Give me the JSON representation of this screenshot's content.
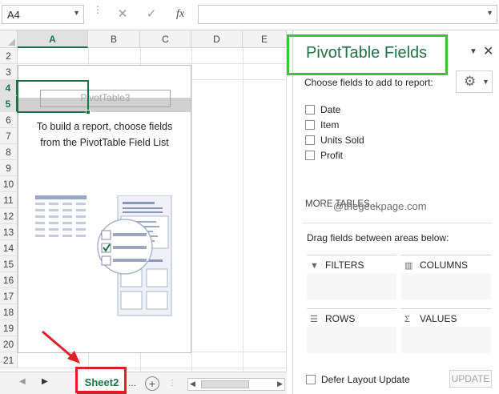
{
  "formula_bar": {
    "namebox_value": "A4",
    "fx_label": "fx",
    "formula_value": ""
  },
  "grid": {
    "columns": [
      "A",
      "B",
      "C",
      "D",
      "E"
    ],
    "selected_column": "A",
    "rows": [
      "2",
      "3",
      "4",
      "5",
      "6",
      "7",
      "8",
      "9",
      "10",
      "11",
      "12",
      "13",
      "14",
      "15",
      "16",
      "17",
      "18",
      "19",
      "20",
      "21"
    ],
    "selected_rows": [
      "4",
      "5"
    ],
    "pivot_name": "PivotTable3",
    "pivot_instruction_line1": "To build a report, choose fields",
    "pivot_instruction_line2": "from the PivotTable Field List"
  },
  "tabs": {
    "active_sheet": "Sheet2",
    "more": "...",
    "add": "+"
  },
  "pane": {
    "title": "PivotTable Fields",
    "choose_label": "Choose fields to add to report:",
    "fields": [
      "Date",
      "Item",
      "Units Sold",
      "Profit"
    ],
    "more_tables": "MORE TABLES...",
    "watermark": "@thegeekpage.com",
    "drag_label": "Drag fields between areas below:",
    "areas": {
      "filters": "FILTERS",
      "columns": "COLUMNS",
      "rows": "ROWS",
      "values": "VALUES"
    },
    "defer_label": "Defer Layout Update",
    "update_label": "UPDATE"
  },
  "colors": {
    "excel_green": "#217346",
    "annotation_red": "#e31f26",
    "annotation_green": "#35c831"
  }
}
